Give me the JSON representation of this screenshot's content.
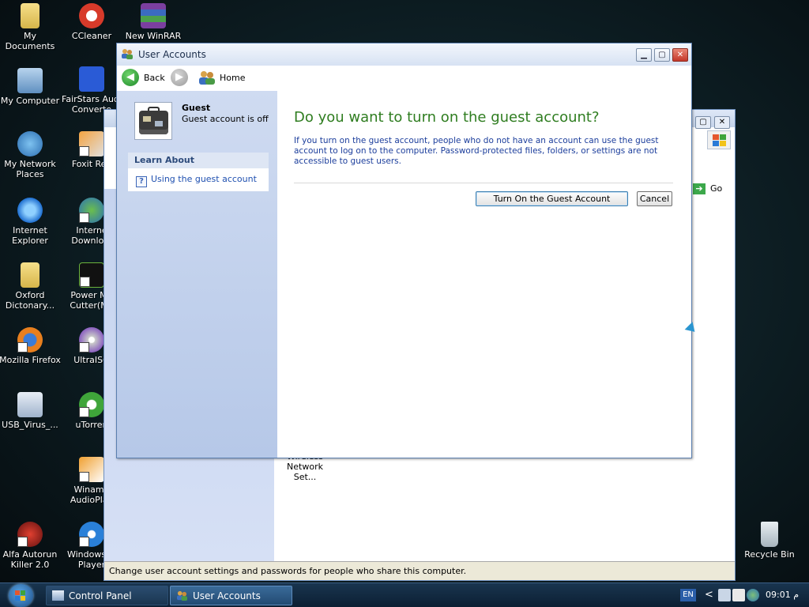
{
  "desktop": {
    "icons": [
      {
        "name": "my-documents-icon",
        "label": "My Documents"
      },
      {
        "name": "ccleaner-icon",
        "label": "CCleaner"
      },
      {
        "name": "new-winrar-icon",
        "label": "New WinRAR"
      },
      {
        "name": "my-computer-icon",
        "label": "My Computer"
      },
      {
        "name": "fairstars-icon",
        "label": "FairStars Audi Converte"
      },
      {
        "name": "my-network-places-icon",
        "label": "My Network Places"
      },
      {
        "name": "foxit-reader-icon",
        "label": "Foxit Rea"
      },
      {
        "name": "internet-explorer-icon",
        "label": "Internet Explorer"
      },
      {
        "name": "internet-download-icon",
        "label": "Interne Downlo..."
      },
      {
        "name": "oxford-dictionary-icon",
        "label": "Oxford Dictonary..."
      },
      {
        "name": "power-mp3-cutter-icon",
        "label": "Power Mp Cutter(Mp"
      },
      {
        "name": "mozilla-firefox-icon",
        "label": "Mozilla Firefox"
      },
      {
        "name": "ultraiso-icon",
        "label": "UltraISO"
      },
      {
        "name": "usb-virus-icon",
        "label": "USB_Virus_..."
      },
      {
        "name": "utorrent-icon",
        "label": "uTorren"
      },
      {
        "name": "winamp-icon",
        "label": "Winamp AudioPlay"
      },
      {
        "name": "alfa-autorun-icon",
        "label": "Alfa Autorun Killer 2.0"
      },
      {
        "name": "windows-media-player-icon",
        "label": "Windows M Player"
      },
      {
        "name": "recycle-bin-icon",
        "label": "Recycle Bin"
      }
    ]
  },
  "control_panel": {
    "go_label": "Go",
    "wireless_label": "Wireless Network Set...",
    "status_text": "Change user account settings and passwords for people who share this computer."
  },
  "user_accounts": {
    "title": "User Accounts",
    "nav": {
      "back": "Back",
      "home": "Home"
    },
    "guest": {
      "name": "Guest",
      "status": "Guest account is off"
    },
    "learn_about": {
      "header": "Learn About",
      "link": "Using the guest account"
    },
    "question": "Do you want to turn on the guest account?",
    "explanation": "If you turn on the guest account, people who do not have an account can use the guest account to log on to the computer. Password-protected files, folders, or settings are not accessible to guest users.",
    "buttons": {
      "turn_on": "Turn On the Guest Account",
      "cancel": "Cancel"
    }
  },
  "taskbar": {
    "tasks": [
      {
        "label": "Control Panel",
        "active": false
      },
      {
        "label": "User Accounts",
        "active": true
      }
    ],
    "language": "EN",
    "tray_expand": "<",
    "clock": "09:01 م"
  },
  "colors": {
    "heading_green": "#2f7d20",
    "link_blue": "#1c3e9c",
    "taskbar": "#19354f"
  }
}
